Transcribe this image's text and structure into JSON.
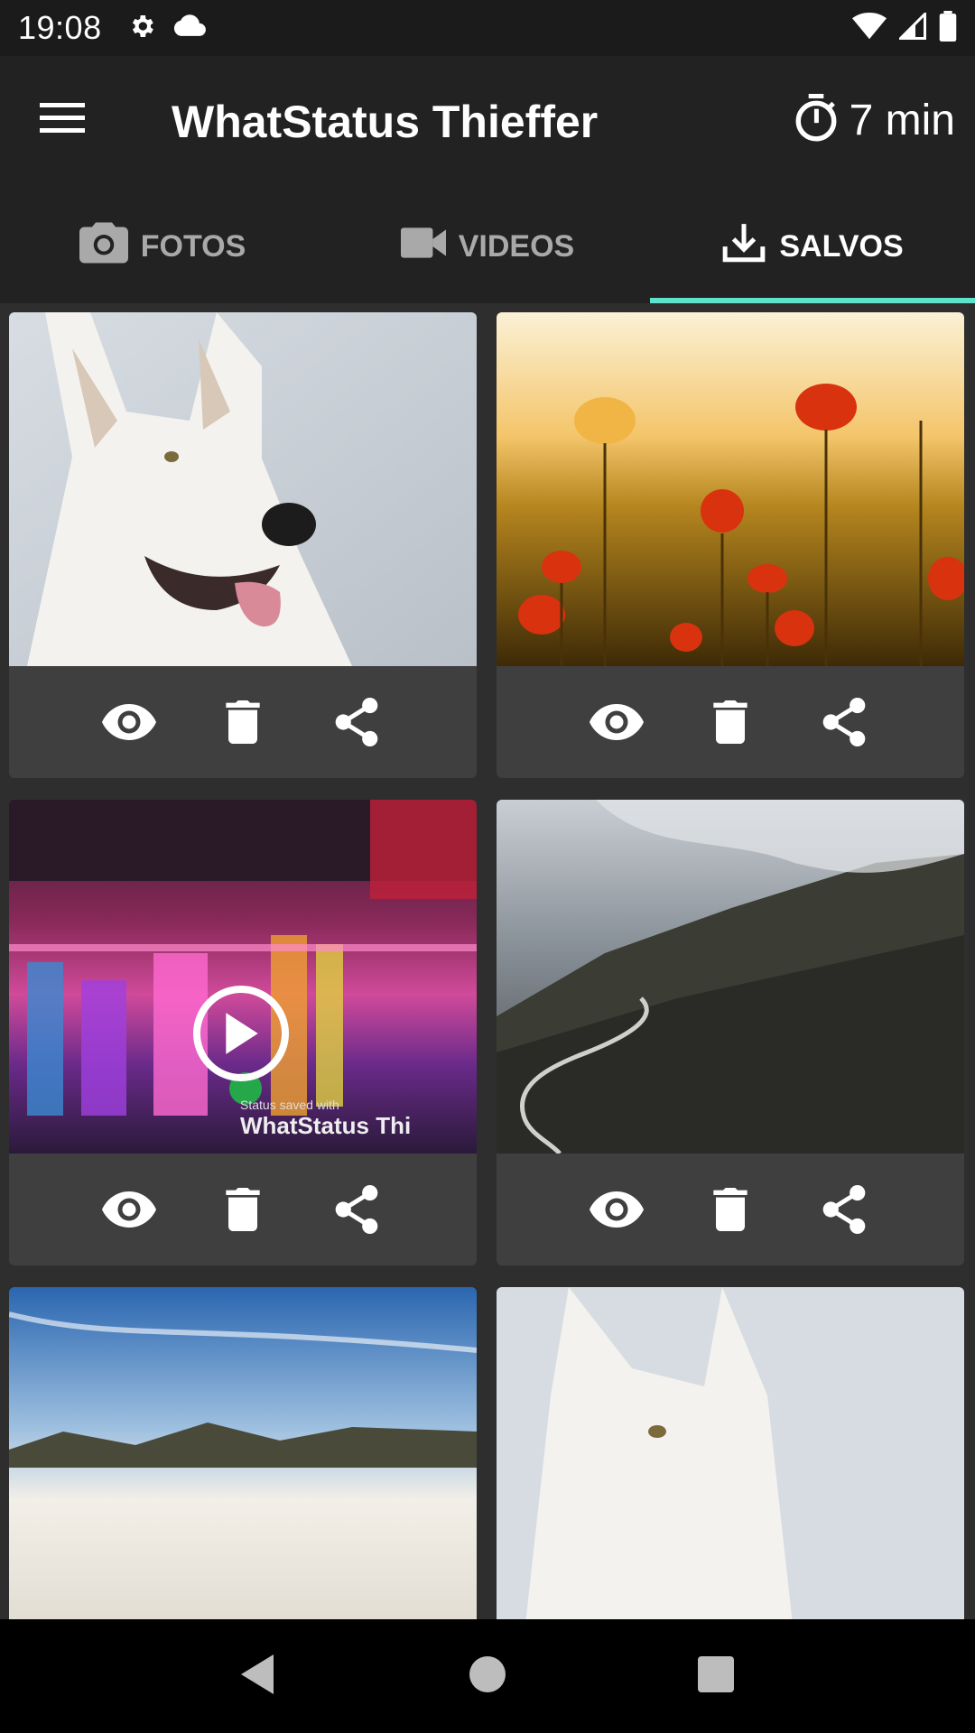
{
  "status_bar": {
    "time": "19:08",
    "icons": [
      "settings-icon",
      "cloud-icon",
      "wifi-icon",
      "signal-icon",
      "battery-icon"
    ]
  },
  "app_bar": {
    "title": "WhatStatus Thieffer",
    "timer_label": "7 min",
    "menu_icon": "menu-icon",
    "timer_icon": "timer-icon"
  },
  "tabs": [
    {
      "label": "FOTOS",
      "icon": "camera-icon",
      "active": false
    },
    {
      "label": "VIDEOS",
      "icon": "video-icon",
      "active": false
    },
    {
      "label": "SALVOS",
      "icon": "download-icon",
      "active": true
    }
  ],
  "colors": {
    "accent": "#5fe2cc",
    "app_bar": "#222222",
    "card": "#3f3f3f",
    "background": "#2e2e2e"
  },
  "cards": [
    {
      "subject": "white-dog",
      "type": "image"
    },
    {
      "subject": "poppy-field",
      "type": "image"
    },
    {
      "subject": "city-reflection",
      "type": "video",
      "watermark_small": "Status saved with",
      "watermark": "WhatStatus Thi"
    },
    {
      "subject": "foggy-mountain-road",
      "type": "image"
    },
    {
      "subject": "sky-clouds",
      "type": "image"
    },
    {
      "subject": "white-dog-top",
      "type": "image"
    }
  ],
  "card_actions": [
    "view-icon",
    "delete-icon",
    "share-icon"
  ],
  "nav_bar": [
    "back-icon",
    "home-icon",
    "recents-icon"
  ]
}
